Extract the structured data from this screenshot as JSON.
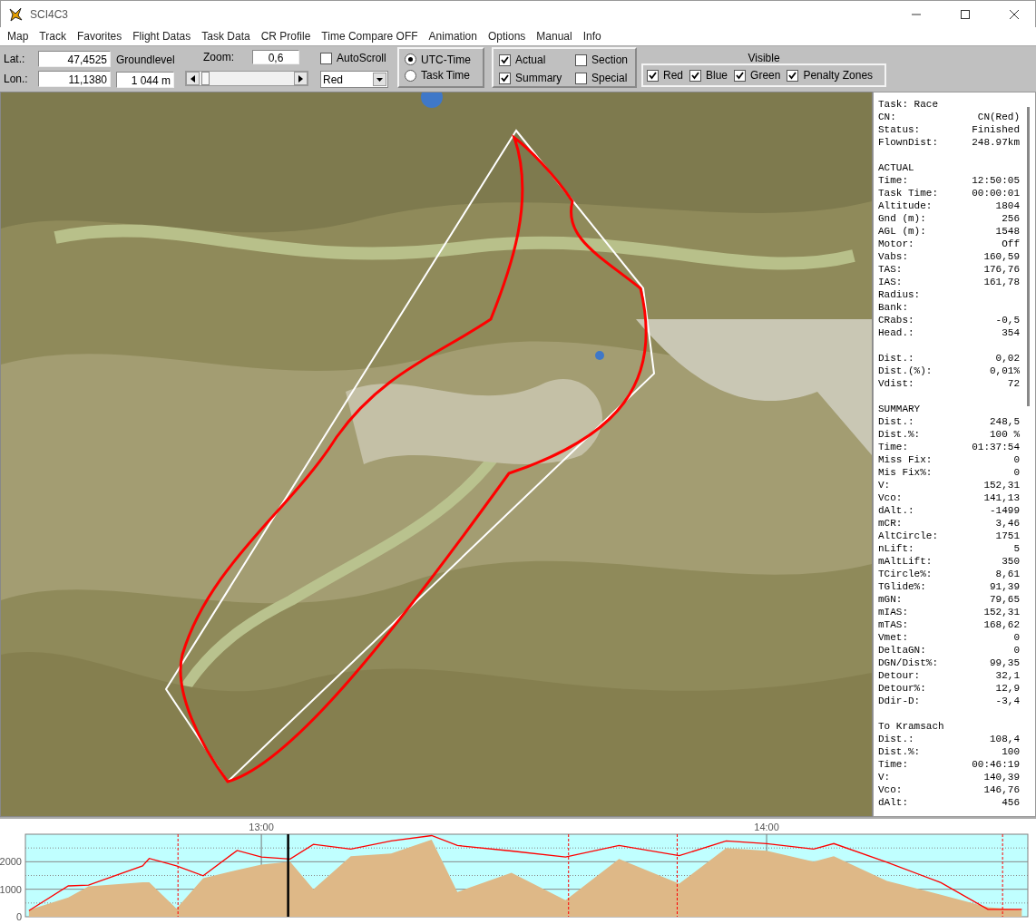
{
  "window": {
    "title": "SCI4C3"
  },
  "menu": [
    "Map",
    "Track",
    "Favorites",
    "Flight Datas",
    "Task Data",
    "CR Profile",
    "Time Compare OFF",
    "Animation",
    "Options",
    "Manual",
    "Info"
  ],
  "toolbar": {
    "lat": {
      "label": "Lat.:",
      "value": "47,4525"
    },
    "lon": {
      "label": "Lon.:",
      "value": "11,1380"
    },
    "groundlevel": {
      "label": "Groundlevel",
      "value": "1 044 m"
    },
    "zoom": {
      "label": "Zoom:",
      "value": "0,6",
      "level": 0.02
    },
    "autoscroll": {
      "label": "AutoScroll",
      "checked": false
    },
    "pilot_dropdown": {
      "value": "Red"
    },
    "time_mode": [
      {
        "label": "UTC-Time",
        "selected": true
      },
      {
        "label": "Task Time",
        "selected": false
      }
    ],
    "options": [
      {
        "label": "Actual",
        "checked": true
      },
      {
        "label": "Section",
        "checked": false
      },
      {
        "label": "Summary",
        "checked": true
      },
      {
        "label": "Special",
        "checked": false
      }
    ],
    "visible": {
      "title": "Visible",
      "items": [
        {
          "label": "Red",
          "checked": true
        },
        {
          "label": "Blue",
          "checked": true
        },
        {
          "label": "Green",
          "checked": true
        },
        {
          "label": "Penalty Zones",
          "checked": true
        }
      ]
    }
  },
  "info_panel": [
    {
      "rows": [
        {
          "label": "Task: Race"
        },
        {
          "label": "CN:",
          "value": "CN(Red)"
        },
        {
          "label": "Status:",
          "value": "Finished"
        },
        {
          "label": "FlownDist:",
          "value": "248.97km"
        }
      ]
    },
    {
      "heading": "ACTUAL",
      "rows": [
        {
          "label": "Time:",
          "value": "12:50:05"
        },
        {
          "label": "Task Time:",
          "value": "00:00:01"
        },
        {
          "label": "Altitude:",
          "value": "1804"
        },
        {
          "label": "Gnd (m):",
          "value": "256"
        },
        {
          "label": "AGL (m):",
          "value": "1548"
        },
        {
          "label": "Motor:",
          "value": "Off"
        },
        {
          "label": "Vabs:",
          "value": "160,59"
        },
        {
          "label": "TAS:",
          "value": "176,76"
        },
        {
          "label": "IAS:",
          "value": "161,78"
        },
        {
          "label": "Radius:"
        },
        {
          "label": "Bank:"
        },
        {
          "label": "CRabs:",
          "value": "-0,5"
        },
        {
          "label": "Head.:",
          "value": "354"
        }
      ]
    },
    {
      "rows": [
        {
          "label": "Dist.:",
          "value": "0,02"
        },
        {
          "label": "Dist.(%):",
          "value": "0,01%"
        },
        {
          "label": "Vdist:",
          "value": "72"
        }
      ]
    },
    {
      "heading": "SUMMARY",
      "rows": [
        {
          "label": "Dist.:",
          "value": "248,5"
        },
        {
          "label": "Dist.%:",
          "value": "100 %"
        },
        {
          "label": "Time:",
          "value": "01:37:54"
        },
        {
          "label": "Miss Fix:",
          "value": "0"
        },
        {
          "label": "Mis Fix%:",
          "value": "0"
        },
        {
          "label": "V:",
          "value": "152,31"
        },
        {
          "label": "Vco:",
          "value": "141,13"
        },
        {
          "label": "dAlt.:",
          "value": "-1499"
        },
        {
          "label": "mCR:",
          "value": "3,46"
        },
        {
          "label": "AltCircle:",
          "value": "1751"
        },
        {
          "label": "nLift:",
          "value": "5"
        },
        {
          "label": "mAltLift:",
          "value": "350"
        },
        {
          "label": "TCircle%:",
          "value": "8,61"
        },
        {
          "label": "TGlide%:",
          "value": "91,39"
        },
        {
          "label": "mGN:",
          "value": "79,65"
        },
        {
          "label": "mIAS:",
          "value": "152,31"
        },
        {
          "label": "mTAS:",
          "value": "168,62"
        },
        {
          "label": "Vmet:",
          "value": "0"
        },
        {
          "label": "DeltaGN:",
          "value": "0"
        },
        {
          "label": "DGN/Dist%:",
          "value": "99,35"
        },
        {
          "label": "Detour:",
          "value": "32,1"
        },
        {
          "label": "Detour%:",
          "value": "12,9"
        },
        {
          "label": "Ddir-D:",
          "value": "-3,4"
        }
      ]
    },
    {
      "heading": "To Kramsach",
      "rows": [
        {
          "label": "Dist.:",
          "value": "108,4"
        },
        {
          "label": "Dist.%:",
          "value": "100"
        },
        {
          "label": "Time:",
          "value": "00:46:19"
        },
        {
          "label": "V:",
          "value": "140,39"
        },
        {
          "label": "Vco:",
          "value": "146,76"
        },
        {
          "label": "dAlt:",
          "value": "456"
        }
      ]
    }
  ],
  "barogram": {
    "chart_data": {
      "type": "area",
      "x": [
        12.54,
        12.618,
        12.658,
        12.765,
        12.778,
        12.832,
        12.885,
        12.952,
        13.0,
        13.057,
        13.103,
        13.177,
        13.257,
        13.337,
        13.388,
        13.495,
        13.602,
        13.708,
        13.827,
        13.92,
        14.0,
        14.093,
        14.133,
        14.238,
        14.345,
        14.438,
        14.505
      ],
      "series": [
        {
          "color": "#deb887",
          "values": [
            250,
            700,
            1100,
            1250,
            1250,
            300,
            1400,
            1700,
            1900,
            2000,
            1000,
            2200,
            2300,
            2800,
            900,
            1600,
            600,
            2100,
            1200,
            2500,
            2400,
            2000,
            2200,
            1300,
            800,
            350,
            250
          ]
        },
        {
          "type": "line",
          "color": "#ff0000",
          "values": [
            220,
            1120,
            1150,
            1850,
            2120,
            1850,
            1490,
            2410,
            2170,
            2100,
            2630,
            2460,
            2760,
            2950,
            2590,
            2390,
            2170,
            2590,
            2220,
            2760,
            2660,
            2460,
            2660,
            1980,
            1240,
            270,
            270
          ]
        }
      ],
      "grid": true,
      "xlim": [
        12.533,
        14.517
      ],
      "ylim": [
        0,
        3000
      ],
      "xticks": [
        {
          "value": 13,
          "label": "13:00"
        },
        {
          "value": 14,
          "label": "14:00"
        }
      ],
      "yticks": [
        0,
        1000,
        2000
      ],
      "ref_lines": [
        {
          "axis": "x",
          "value": 13.053,
          "color": "#000000"
        },
        {
          "axis": "x",
          "value": 12.835,
          "color": "#ff0000"
        },
        {
          "axis": "x",
          "value": 13.608,
          "color": "#ff0000"
        },
        {
          "axis": "x",
          "value": 13.823,
          "color": "#ff0000"
        },
        {
          "axis": "x",
          "value": 14.467,
          "color": "#ff0000"
        }
      ]
    }
  }
}
